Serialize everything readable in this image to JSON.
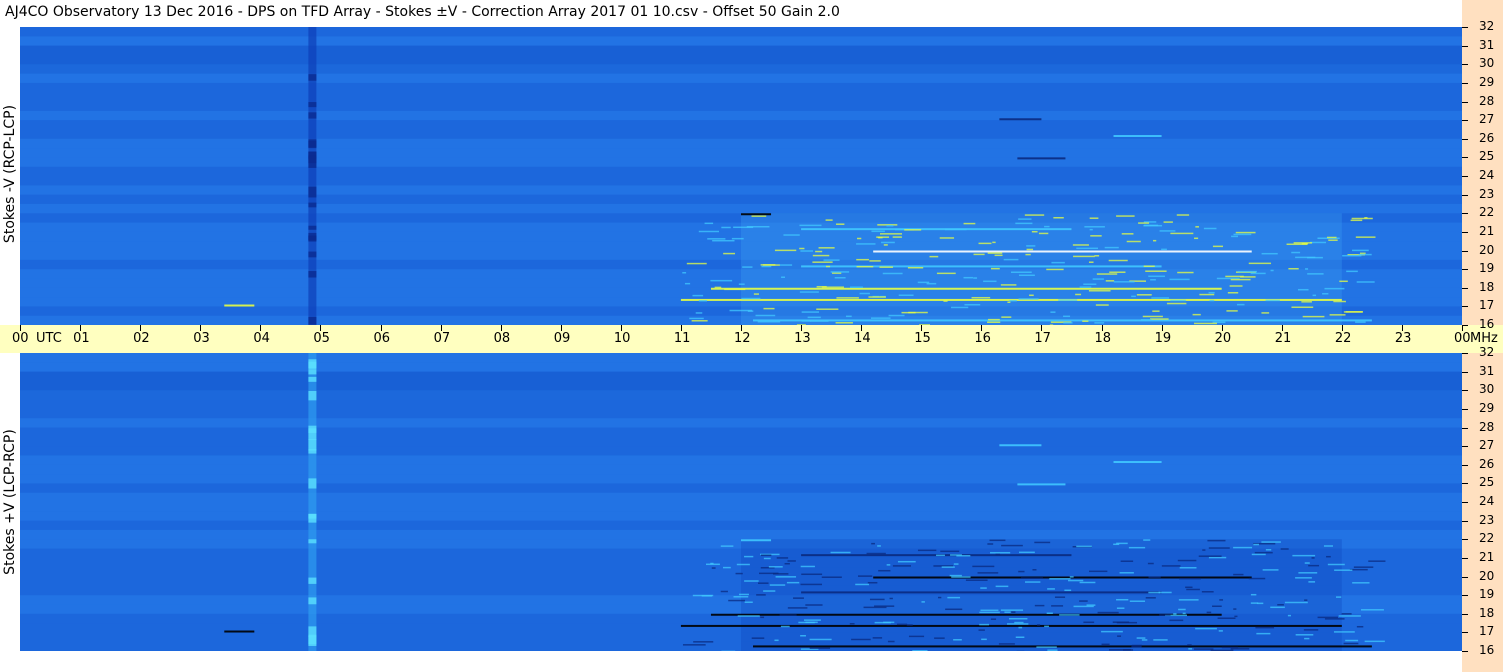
{
  "title": "AJ4CO Observatory  13 Dec 2016  -  DPS on TFD Array  -  Stokes ±V  -  Correction Array 2017 01 10.csv  -  Offset 50  Gain 2.0",
  "colors": {
    "background_blue": "#1f6ee0",
    "dark_band": "#1050c8",
    "bright": "#40c8ff",
    "hot": "#e8ff40",
    "timebar": "#ffffc0",
    "freq_strip": "#ffe0c0"
  },
  "chart_data": [
    {
      "type": "heatmap",
      "ylabel": "Stokes -V  (RCP-LCP)",
      "ylim": [
        16,
        32
      ],
      "y_ticks": [
        "32",
        "31",
        "30",
        "29",
        "28",
        "27",
        "26",
        "25",
        "24",
        "23",
        "22",
        "21",
        "20",
        "19",
        "18",
        "17",
        "16"
      ],
      "xlim": [
        0,
        24
      ],
      "x_ticks": [
        "00",
        "01",
        "02",
        "03",
        "04",
        "05",
        "06",
        "07",
        "08",
        "09",
        "10",
        "11",
        "12",
        "13",
        "14",
        "15",
        "16",
        "17",
        "18",
        "19",
        "20",
        "21",
        "22",
        "23",
        "00"
      ],
      "x_unit": "UTC",
      "y_unit": "MHz"
    },
    {
      "type": "heatmap",
      "ylabel": "Stokes +V  (LCP-RCP)",
      "ylim": [
        16,
        32
      ],
      "y_ticks": [
        "32",
        "31",
        "30",
        "29",
        "28",
        "27",
        "26",
        "25",
        "24",
        "23",
        "22",
        "21",
        "20",
        "19",
        "18",
        "17",
        "16"
      ],
      "xlim": [
        0,
        24
      ],
      "x_ticks": [
        "00",
        "01",
        "02",
        "03",
        "04",
        "05",
        "06",
        "07",
        "08",
        "09",
        "10",
        "11",
        "12",
        "13",
        "14",
        "15",
        "16",
        "17",
        "18",
        "19",
        "20",
        "21",
        "22",
        "23",
        "00"
      ],
      "x_unit": "UTC",
      "y_unit": "MHz"
    }
  ]
}
